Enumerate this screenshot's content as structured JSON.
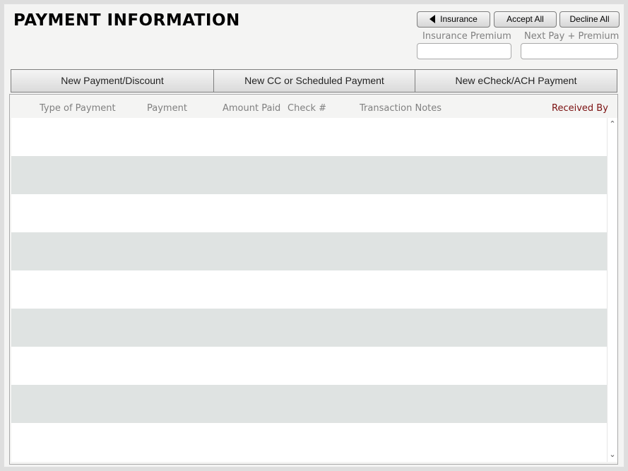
{
  "header": {
    "title": "PAYMENT INFORMATION"
  },
  "toolbar": {
    "insurance_label": "Insurance",
    "accept_all_label": "Accept All",
    "decline_all_label": "Decline All"
  },
  "fields": {
    "insurance_premium": {
      "label": "Insurance Premium",
      "value": ""
    },
    "next_pay_premium": {
      "label": "Next Pay + Premium",
      "value": ""
    }
  },
  "actions": {
    "new_payment_discount": "New Payment/Discount",
    "new_cc_scheduled": "New CC or Scheduled Payment",
    "new_echeck_ach": "New eCheck/ACH Payment"
  },
  "table": {
    "columns": {
      "type_of_payment": "Type of Payment",
      "payment": "Payment",
      "amount_paid": "Amount Paid",
      "check_no": "Check #",
      "transaction_notes": "Transaction Notes",
      "received_by": "Received By"
    },
    "rows": []
  },
  "colors": {
    "received_by_header": "#7b1010",
    "row_alt": "#dfe3e2"
  },
  "icons": {
    "back": "triangle-left-icon",
    "scroll_up": "chevron-up-icon",
    "scroll_down": "chevron-down-icon"
  }
}
